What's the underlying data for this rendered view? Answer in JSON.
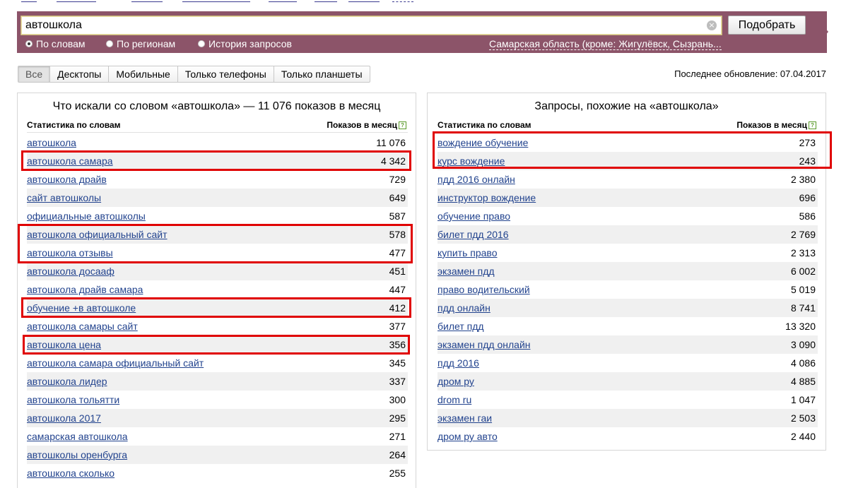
{
  "search": {
    "query": "автошкола",
    "submit_label": "Подобрать",
    "clear_icon": "close-icon"
  },
  "modes": [
    {
      "label": "По словам",
      "selected": true
    },
    {
      "label": "По регионам",
      "selected": false
    },
    {
      "label": "История запросов",
      "selected": false
    }
  ],
  "region_label": "Самарская область (кроме: Жигулёвск, Сызрань...",
  "device_tabs": [
    {
      "label": "Все",
      "active": true
    },
    {
      "label": "Десктопы",
      "active": false
    },
    {
      "label": "Мобильные",
      "active": false
    },
    {
      "label": "Только телефоны",
      "active": false
    },
    {
      "label": "Только планшеты",
      "active": false
    }
  ],
  "last_update": "Последнее обновление: 07.04.2017",
  "left_panel": {
    "title": "Что искали со словом «автошкола» — 11 076 показов в месяц",
    "col_keyword": "Статистика по словам",
    "col_count": "Показов в месяц",
    "rows": [
      {
        "keyword": "автошкола",
        "count": "11 076"
      },
      {
        "keyword": "автошкола самара",
        "count": "4 342"
      },
      {
        "keyword": "автошкола драйв",
        "count": "729"
      },
      {
        "keyword": "сайт автошколы",
        "count": "649"
      },
      {
        "keyword": "официальные автошколы",
        "count": "587"
      },
      {
        "keyword": "автошкола официальный сайт",
        "count": "578"
      },
      {
        "keyword": "автошкола отзывы",
        "count": "477"
      },
      {
        "keyword": "автошкола досааф",
        "count": "451"
      },
      {
        "keyword": "автошкола драйв самара",
        "count": "447"
      },
      {
        "keyword": "обучение +в автошколе",
        "count": "412"
      },
      {
        "keyword": "автошкола самары сайт",
        "count": "377"
      },
      {
        "keyword": "автошкола цена",
        "count": "356"
      },
      {
        "keyword": "автошкола самара официальный сайт",
        "count": "345"
      },
      {
        "keyword": "автошкола лидер",
        "count": "337"
      },
      {
        "keyword": "автошкола тольятти",
        "count": "300"
      },
      {
        "keyword": "автошкола 2017",
        "count": "295"
      },
      {
        "keyword": "самарская автошкола",
        "count": "271"
      },
      {
        "keyword": "автошколы оренбурга",
        "count": "264"
      },
      {
        "keyword": "автошкола сколько",
        "count": "255"
      }
    ]
  },
  "right_panel": {
    "title": "Запросы, похожие на «автошкола»",
    "col_keyword": "Статистика по словам",
    "col_count": "Показов в месяц",
    "rows": [
      {
        "keyword": "вождение обучение",
        "count": "273"
      },
      {
        "keyword": "курс вождение",
        "count": "243"
      },
      {
        "keyword": "пдд 2016 онлайн",
        "count": "2 380"
      },
      {
        "keyword": "инструктор вождение",
        "count": "696"
      },
      {
        "keyword": "обучение право",
        "count": "586"
      },
      {
        "keyword": "билет пдд 2016",
        "count": "2 769"
      },
      {
        "keyword": "купить право",
        "count": "2 313"
      },
      {
        "keyword": "экзамен пдд",
        "count": "6 002"
      },
      {
        "keyword": "право водительский",
        "count": "5 019"
      },
      {
        "keyword": "пдд онлайн",
        "count": "8 741"
      },
      {
        "keyword": "билет пдд",
        "count": "13 320"
      },
      {
        "keyword": "экзамен пдд онлайн",
        "count": "3 090"
      },
      {
        "keyword": "пдд 2016",
        "count": "4 086"
      },
      {
        "keyword": "дром ру",
        "count": "4 885"
      },
      {
        "keyword": "drom ru",
        "count": "1 047"
      },
      {
        "keyword": "экзамен гаи",
        "count": "2 503"
      },
      {
        "keyword": "дром ру авто",
        "count": "2 440"
      }
    ]
  },
  "colors": {
    "band": "#8c5469",
    "link": "#22438e",
    "highlight": "#e00000",
    "alt_row": "#f0f0f0"
  }
}
